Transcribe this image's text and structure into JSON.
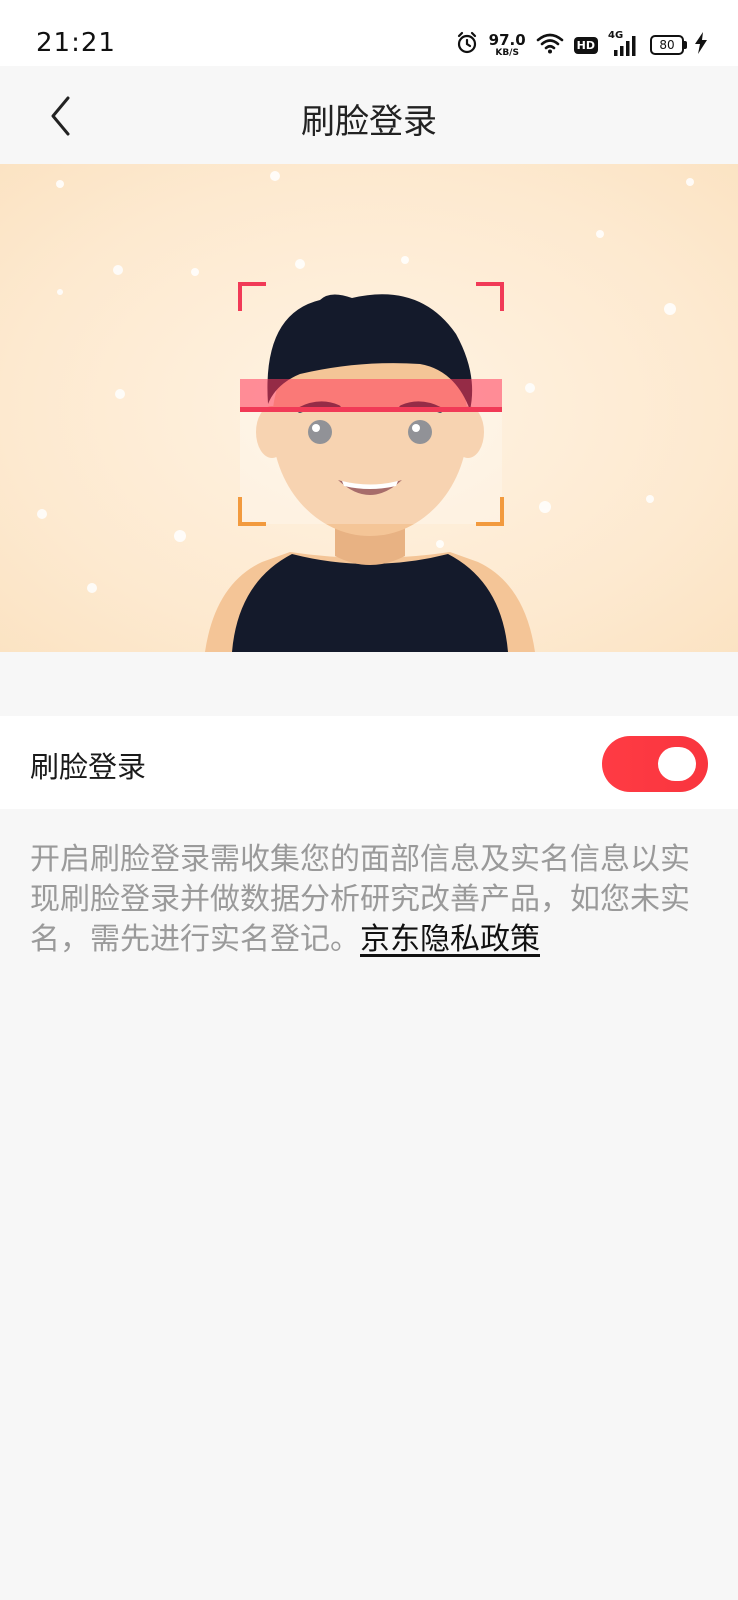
{
  "status_bar": {
    "time": "21:21",
    "net_speed_value": "97.0",
    "net_speed_unit": "KB/S",
    "hd_label": "HD",
    "network_type": "4G",
    "battery_level": "80",
    "icons": [
      "alarm-icon",
      "wifi-icon",
      "hd-icon",
      "signal-icon",
      "battery-icon",
      "charging-icon"
    ]
  },
  "nav": {
    "title": "刷脸登录",
    "back_icon": "chevron-left-icon"
  },
  "hero": {
    "illustration": "face-scan-illustration"
  },
  "setting": {
    "label": "刷脸登录",
    "toggle_on": true,
    "toggle_color": "#ff3b44"
  },
  "description": {
    "text": "开启刷脸登录需收集您的面部信息及实名信息以实现刷脸登录并做数据分析研究改善产品，如您未实名，需先进行实名登记。",
    "link_text": "京东隐私政策"
  }
}
